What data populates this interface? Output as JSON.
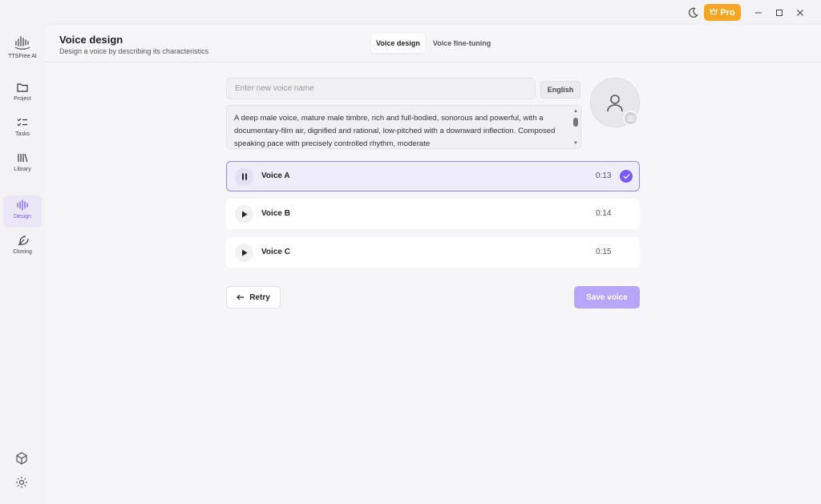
{
  "app": {
    "name": "TTSFree AI",
    "pro_label": "Pro",
    "accent_color": "#7a5af5",
    "pro_color": "#f5a623"
  },
  "sidebar": {
    "items": [
      {
        "label": "Project",
        "icon": "folder-icon"
      },
      {
        "label": "Tasks",
        "icon": "tasks-icon"
      },
      {
        "label": "Library",
        "icon": "library-icon"
      },
      {
        "label": "Design",
        "icon": "waveform-icon",
        "active": true
      },
      {
        "label": "Cloning",
        "icon": "feather-icon"
      }
    ],
    "bottom_icons": [
      "cube-icon",
      "gear-icon"
    ]
  },
  "header": {
    "title": "Voice design",
    "subtitle": "Design a voice by describing its characteristics",
    "tabs": [
      {
        "label": "Voice design",
        "active": true
      },
      {
        "label": "Voice fine-tuning",
        "active": false
      }
    ]
  },
  "form": {
    "name_placeholder": "Enter new voice name",
    "name_value": "",
    "language": "English",
    "description": "A deep male voice, mature male timbre, rich and full-bodied, sonorous and powerful, with a documentary-film air, dignified and rational, low-pitched with a downward inflection. Composed speaking pace with precisely controlled rhythm, moderate"
  },
  "voices": [
    {
      "name": "Voice A",
      "duration": "0:13",
      "playing": true,
      "selected": true
    },
    {
      "name": "Voice B",
      "duration": "0:14",
      "playing": false,
      "selected": false
    },
    {
      "name": "Voice C",
      "duration": "0:15",
      "playing": false,
      "selected": false
    }
  ],
  "actions": {
    "retry_label": "Retry",
    "save_label": "Save voice"
  }
}
